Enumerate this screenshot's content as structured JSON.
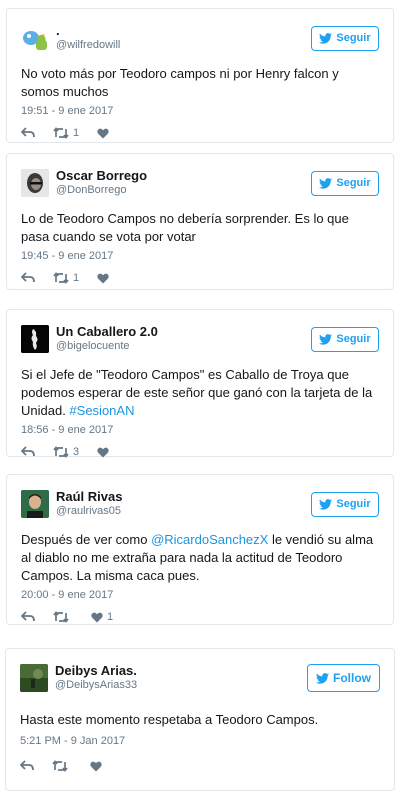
{
  "tweets": [
    {
      "name": ".",
      "handle": "@wilfredowill",
      "follow_label": "Seguir",
      "text": "No voto más por Teodoro campos ni por Henry falcon y somos muchos",
      "time": "19:51 - 9 ene 2017",
      "retweets": "1",
      "likes": ""
    },
    {
      "name": "Oscar Borrego",
      "handle": "@DonBorrego",
      "follow_label": "Seguir",
      "text": "Lo de Teodoro Campos no debería sorprender. Es lo que pasa cuando se vota por votar",
      "time": "19:45 - 9 ene 2017",
      "retweets": "1",
      "likes": ""
    },
    {
      "name": "Un Caballero 2.0",
      "handle": "@bigelocuente",
      "follow_label": "Seguir",
      "text_before": "Si el Jefe de \"Teodoro Campos\" es Caballo de Troya que podemos esperar de este señor que ganó con la tarjeta de la Unidad. ",
      "hashtag": "#SesionAN",
      "time": "18:56 - 9 ene 2017",
      "retweets": "3",
      "likes": ""
    },
    {
      "name": "Raúl Rivas",
      "handle": "@raulrivas05",
      "follow_label": "Seguir",
      "text_before": "Después de ver como ",
      "mention": "@RicardoSanchezX",
      "text_after": " le vendió su alma al diablo no me extraña para nada la actitud de Teodoro Campos. La misma caca pues.",
      "time": "20:00 - 9 ene 2017",
      "retweets": "",
      "likes": "1"
    },
    {
      "name": "Deibys Arias.",
      "handle": "@DeibysArias33",
      "follow_label": "Follow",
      "text": "Hasta este momento respetaba a Teodoro Campos.",
      "time": "5:21 PM - 9 Jan 2017",
      "retweets": "",
      "likes": ""
    }
  ],
  "icons": {
    "bird": "twitter-bird-icon",
    "reply": "reply-icon",
    "retweet": "retweet-icon",
    "like": "heart-icon"
  },
  "colors": {
    "accent": "#1da1f2",
    "link": "#1b95e0",
    "muted": "#657786",
    "border": "#e1e8ed"
  }
}
